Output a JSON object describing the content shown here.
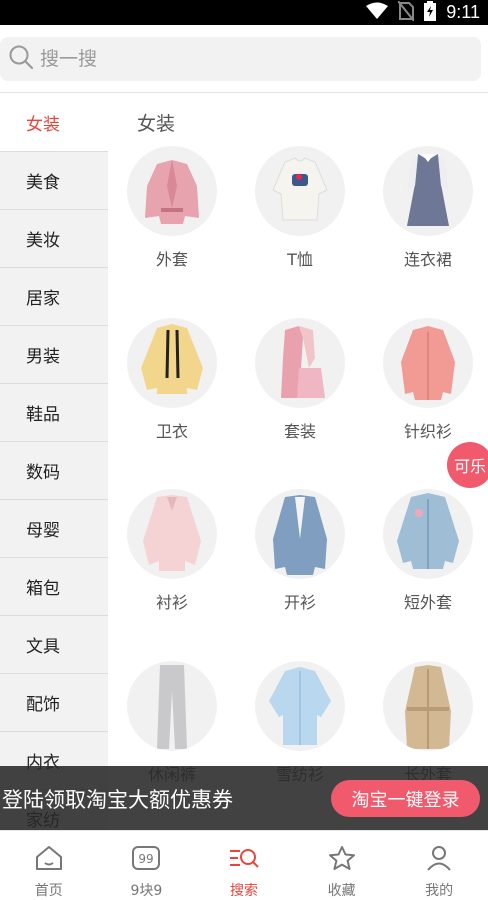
{
  "status_bar": {
    "time": "9:11"
  },
  "search": {
    "placeholder": "搜一搜"
  },
  "sidebar": {
    "items": [
      {
        "label": "女装"
      },
      {
        "label": "美食"
      },
      {
        "label": "美妆"
      },
      {
        "label": "居家"
      },
      {
        "label": "男装"
      },
      {
        "label": "鞋品"
      },
      {
        "label": "数码"
      },
      {
        "label": "母婴"
      },
      {
        "label": "箱包"
      },
      {
        "label": "文具"
      },
      {
        "label": "配饰"
      },
      {
        "label": "内衣"
      },
      {
        "label": "家纺"
      }
    ],
    "active_index": 0
  },
  "content": {
    "title": "女装",
    "items": [
      {
        "label": "外套",
        "icon": "pink-jacket-icon"
      },
      {
        "label": "T恤",
        "icon": "tshirt-icon"
      },
      {
        "label": "连衣裙",
        "icon": "dress-icon"
      },
      {
        "label": "卫衣",
        "icon": "hoodie-icon"
      },
      {
        "label": "套装",
        "icon": "outfit-set-icon"
      },
      {
        "label": "针织衫",
        "icon": "knit-cardigan-icon"
      },
      {
        "label": "衬衫",
        "icon": "blouse-icon"
      },
      {
        "label": "开衫",
        "icon": "blue-cardigan-icon"
      },
      {
        "label": "短外套",
        "icon": "denim-jacket-icon"
      },
      {
        "label": "休闲裤",
        "icon": "pants-icon"
      },
      {
        "label": "雪纺衫",
        "icon": "chiffon-shirt-icon"
      },
      {
        "label": "长外套",
        "icon": "trench-coat-icon"
      }
    ]
  },
  "float_badge": {
    "label": "可乐"
  },
  "banner": {
    "text": "登陆领取淘宝大额优惠券",
    "button_label": "淘宝一键登录"
  },
  "tabbar": {
    "items": [
      {
        "label": "首页",
        "icon": "home-icon"
      },
      {
        "label": "9块9",
        "icon": "nine-nine-icon"
      },
      {
        "label": "搜索",
        "icon": "search-filter-icon"
      },
      {
        "label": "收藏",
        "icon": "star-icon"
      },
      {
        "label": "我的",
        "icon": "user-icon"
      }
    ],
    "active_index": 2
  },
  "colors": {
    "accent": "#e8443a",
    "badge": "#f05a6c",
    "banner_bg": "#282828"
  }
}
